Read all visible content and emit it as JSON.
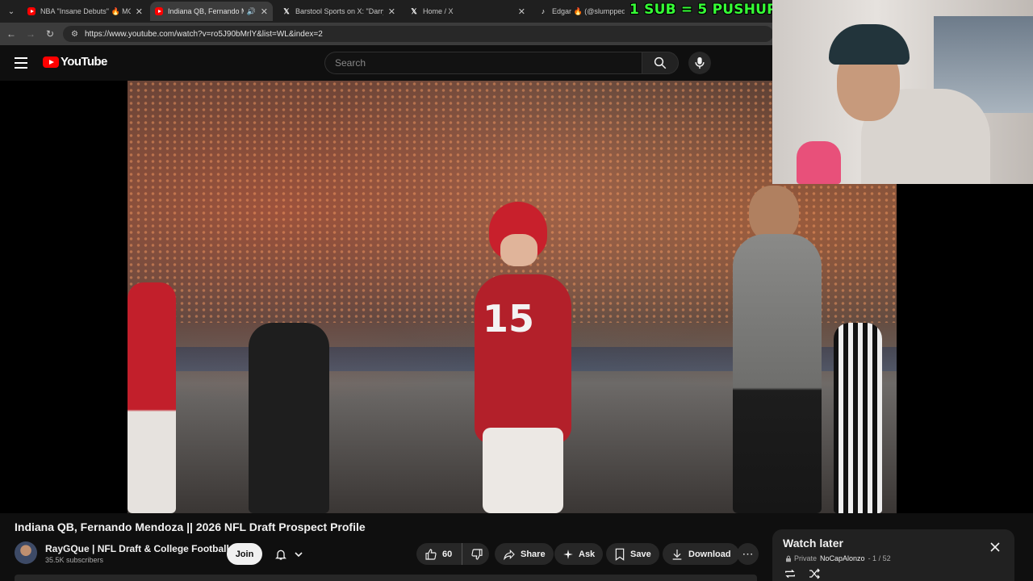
{
  "browser": {
    "tabs": [
      {
        "title": "NBA \"Insane Debuts\" 🔥 MOM",
        "icon": "youtube-icon",
        "active": false
      },
      {
        "title": "Indiana QB, Fernando Men",
        "icon": "youtube-icon",
        "active": true
      },
      {
        "title": "Barstool Sports on X: \"Darryn P",
        "icon": "x-icon",
        "active": false
      },
      {
        "title": "Home / X",
        "icon": "x-icon",
        "active": false
      },
      {
        "title": "Edgar 🔥 (@slumppedgar)",
        "icon": "tiktok-icon",
        "active": false
      }
    ],
    "url": "https://www.youtube.com/watch?v=ro5J90bMrlY&list=WL&index=2"
  },
  "overlay": {
    "sub_text": "1 SUB = 5 PUSHUPS"
  },
  "header": {
    "logo_text": "YouTube",
    "search_placeholder": "Search"
  },
  "video": {
    "title": "Indiana QB, Fernando Mendoza || 2026 NFL Draft Prospect Profile",
    "jersey_number": "15"
  },
  "channel": {
    "name": "RayGQue | NFL Draft & College Football",
    "subscribers": "35.5K subscribers",
    "join_label": "Join"
  },
  "actions": {
    "like_count": "60",
    "share_label": "Share",
    "ask_label": "Ask",
    "save_label": "Save",
    "download_label": "Download"
  },
  "playlist": {
    "title": "Watch later",
    "privacy": "Private",
    "owner": "NoCapAlonzo",
    "position": "- 1 / 52"
  },
  "colors": {
    "background": "#0f0f0f",
    "brand_red": "#ff0000",
    "overlay_green": "#36ff36",
    "pill_bg": "#272727"
  }
}
